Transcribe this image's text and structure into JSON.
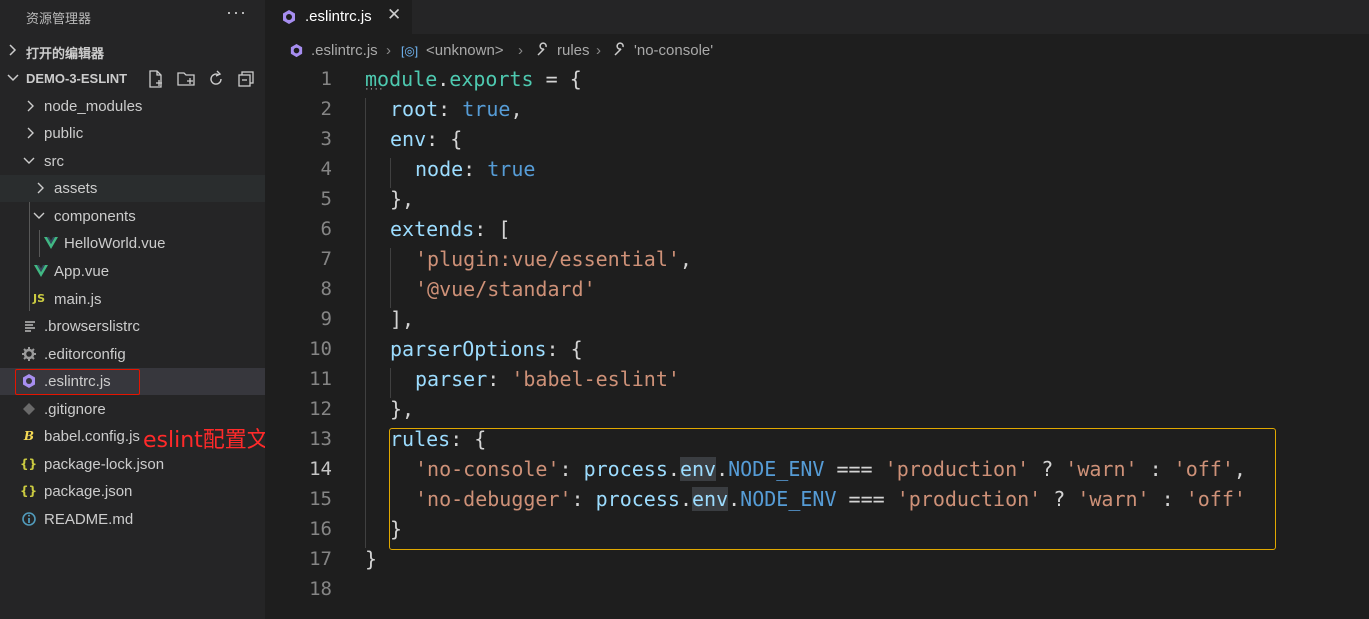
{
  "sidebar": {
    "title": "资源管理器",
    "more_label": "···",
    "open_editors_label": "打开的编辑器",
    "project_label": "DEMO-3-ESLINT",
    "actions": [
      "new-file",
      "new-folder",
      "refresh",
      "collapse-all"
    ],
    "tree": [
      {
        "name": "node_modules",
        "icon": "chevron-right-icon",
        "kind": "folder"
      },
      {
        "name": "public",
        "icon": "chevron-right-icon",
        "kind": "folder"
      },
      {
        "name": "src",
        "icon": "chevron-down-icon",
        "kind": "folder"
      },
      {
        "name": "assets",
        "icon": "chevron-right-icon",
        "kind": "folder"
      },
      {
        "name": "components",
        "icon": "chevron-down-icon",
        "kind": "folder"
      },
      {
        "name": "HelloWorld.vue",
        "icon": "vue-icon",
        "kind": "file"
      },
      {
        "name": "App.vue",
        "icon": "vue-icon",
        "kind": "file"
      },
      {
        "name": "main.js",
        "icon": "js-icon",
        "kind": "file",
        "icon_text": "JS"
      },
      {
        "name": ".browserslistrc",
        "icon": "list-icon",
        "kind": "file"
      },
      {
        "name": ".editorconfig",
        "icon": "gear-icon",
        "kind": "file"
      },
      {
        "name": ".eslintrc.js",
        "icon": "eslint-icon",
        "kind": "file"
      },
      {
        "name": ".gitignore",
        "icon": "git-icon",
        "kind": "file"
      },
      {
        "name": "babel.config.js",
        "icon": "babel-icon",
        "kind": "file"
      },
      {
        "name": "package-lock.json",
        "icon": "json-icon",
        "kind": "file",
        "icon_text": "{}"
      },
      {
        "name": "package.json",
        "icon": "json-icon",
        "kind": "file",
        "icon_text": "{}"
      },
      {
        "name": "README.md",
        "icon": "info-icon",
        "kind": "file"
      }
    ],
    "annotation": "eslint配置文件"
  },
  "editor": {
    "tab_label": ".eslintrc.js",
    "tab_close": "✕",
    "breadcrumb": [
      ".eslintrc.js",
      "<unknown>",
      "rules",
      "'no-console'"
    ],
    "line_numbers": [
      "1",
      "2",
      "3",
      "4",
      "5",
      "6",
      "7",
      "8",
      "9",
      "10",
      "11",
      "12",
      "13",
      "14",
      "15",
      "16",
      "17",
      "18"
    ],
    "current_line": "14",
    "code": {
      "l1": {
        "a": "module",
        "b": ".",
        "c": "exports",
        "d": " = {"
      },
      "l2": {
        "a": "root",
        "b": ": ",
        "c": "true",
        "d": ","
      },
      "l3": {
        "a": "env",
        "b": ": {"
      },
      "l4": {
        "a": "node",
        "b": ": ",
        "c": "true"
      },
      "l5": {
        "a": "},"
      },
      "l6": {
        "a": "extends",
        "b": ": ["
      },
      "l7": {
        "a": "'plugin:vue/essential'",
        "b": ","
      },
      "l8": {
        "a": "'@vue/standard'"
      },
      "l9": {
        "a": "],"
      },
      "l10": {
        "a": "parserOptions",
        "b": ": {"
      },
      "l11": {
        "a": "parser",
        "b": ": ",
        "c": "'babel-eslint'"
      },
      "l12": {
        "a": "},"
      },
      "l13": {
        "a": "rules",
        "b": ": {"
      },
      "l14": {
        "a": "'no-console'",
        "b": ": ",
        "c": "process",
        "d": ".",
        "e": "env",
        "f": ".",
        "g": "NODE_ENV",
        "h": " === ",
        "i": "'production'",
        "j": " ? ",
        "k": "'warn'",
        "l": " : ",
        "m": "'off'",
        "n": ","
      },
      "l15": {
        "a": "'no-debugger'",
        "b": ": ",
        "c": "process",
        "d": ".",
        "e": "env",
        "f": ".",
        "g": "NODE_ENV",
        "h": " === ",
        "i": "'production'",
        "j": " ? ",
        "k": "'warn'",
        "l": " : ",
        "m": "'off'"
      },
      "l16": {
        "a": "}"
      },
      "l17": {
        "a": "}"
      }
    }
  },
  "colors": {
    "sidebar_bg": "#252526",
    "editor_bg": "#1e1e1e",
    "string": "#ce9178",
    "keyword": "#569cd6",
    "property": "#9cdcfe",
    "annotation_red": "#ff2a2a",
    "highlight_box": "#e0a800"
  }
}
